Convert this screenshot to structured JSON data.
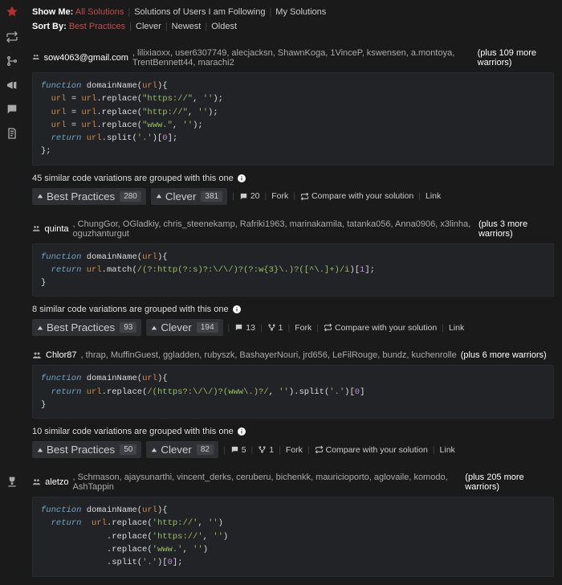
{
  "filters": {
    "show_me_label": "Show Me:",
    "show_me_opts": [
      "All Solutions",
      "Solutions of Users I am Following",
      "My Solutions"
    ],
    "show_me_active": 0,
    "sort_by_label": "Sort By:",
    "sort_by_opts": [
      "Best Practices",
      "Clever",
      "Newest",
      "Oldest"
    ],
    "sort_by_active": 0
  },
  "action_labels": {
    "best_practices": "Best Practices",
    "clever": "Clever",
    "fork": "Fork",
    "compare": "Compare with your solution",
    "link": "Link"
  },
  "solutions": [
    {
      "primary_user": "sow4063@gmail.com",
      "other_users": ", lilixiaoxx, user6307749, alecjacksn, ShawnKoga, 1VinceP, kswensen, a.montoya, TrentBennett44, marachi2 ",
      "plus": "(plus 109 more warriors)",
      "code_html": "<span class=\"tok-kw\">function</span> <span class=\"tok-fn\">domainName</span><span class=\"tok-p\">(</span><span class=\"tok-id\">url</span><span class=\"tok-p\">){</span>\n  <span class=\"tok-id\">url</span> <span class=\"tok-o\">=</span> <span class=\"tok-id\">url</span><span class=\"tok-p\">.</span><span class=\"tok-fn\">replace</span><span class=\"tok-p\">(</span><span class=\"tok-s\">\"https://\"</span><span class=\"tok-p\">, </span><span class=\"tok-s\">''</span><span class=\"tok-p\">);</span>\n  <span class=\"tok-id\">url</span> <span class=\"tok-o\">=</span> <span class=\"tok-id\">url</span><span class=\"tok-p\">.</span><span class=\"tok-fn\">replace</span><span class=\"tok-p\">(</span><span class=\"tok-s\">\"http://\"</span><span class=\"tok-p\">, </span><span class=\"tok-s\">''</span><span class=\"tok-p\">);</span>\n  <span class=\"tok-id\">url</span> <span class=\"tok-o\">=</span> <span class=\"tok-id\">url</span><span class=\"tok-p\">.</span><span class=\"tok-fn\">replace</span><span class=\"tok-p\">(</span><span class=\"tok-s\">\"www.\"</span><span class=\"tok-p\">, </span><span class=\"tok-s\">''</span><span class=\"tok-p\">);</span>\n  <span class=\"tok-kw\">return</span> <span class=\"tok-id\">url</span><span class=\"tok-p\">.</span><span class=\"tok-fn\">split</span><span class=\"tok-p\">(</span><span class=\"tok-s\">'.'</span><span class=\"tok-p\">)[</span><span class=\"tok-n\">0</span><span class=\"tok-p\">];</span>\n<span class=\"tok-p\">};</span>",
      "grouped": "45 similar code variations are grouped with this one",
      "bp": "280",
      "cl": "381",
      "comments": "20",
      "forks": null
    },
    {
      "primary_user": "quinta",
      "other_users": ", ChungGor, OGladkiy, chris_steenekamp, Rafriki1963, marinakamila, tatanka056, Anna0906, x3linha, oguzhanturgut ",
      "plus": "(plus 3 more warriors)",
      "code_html": "<span class=\"tok-kw\">function</span> <span class=\"tok-fn\">domainName</span><span class=\"tok-p\">(</span><span class=\"tok-id\">url</span><span class=\"tok-p\">){</span>\n  <span class=\"tok-kw\">return</span> <span class=\"tok-id\">url</span><span class=\"tok-p\">.</span><span class=\"tok-fn\">match</span><span class=\"tok-p\">(</span><span class=\"tok-s\">/(?:http(?:s)?:\\/\\/)?(?:w{3}\\.)?([^\\.]+)/i</span><span class=\"tok-p\">)[</span><span class=\"tok-n\">1</span><span class=\"tok-p\">];</span>\n<span class=\"tok-p\">}</span>",
      "grouped": "8 similar code variations are grouped with this one",
      "bp": "93",
      "cl": "194",
      "comments": "13",
      "forks": "1"
    },
    {
      "primary_user": "Chlor87",
      "other_users": ", thrap, MuffinGuest, ggladden, rubyszk, BashayerNouri, jrd656, LeFilRouge, bundz, kuchenrolle ",
      "plus": "(plus 6 more warriors)",
      "code_html": "<span class=\"tok-kw\">function</span> <span class=\"tok-fn\">domainName</span><span class=\"tok-p\">(</span><span class=\"tok-id\">url</span><span class=\"tok-p\">){</span>\n  <span class=\"tok-kw\">return</span> <span class=\"tok-id\">url</span><span class=\"tok-p\">.</span><span class=\"tok-fn\">replace</span><span class=\"tok-p\">(</span><span class=\"tok-s\">/(https?:\\/\\/)?(www\\.)?/</span><span class=\"tok-p\">, </span><span class=\"tok-s\">''</span><span class=\"tok-p\">).</span><span class=\"tok-fn\">split</span><span class=\"tok-p\">(</span><span class=\"tok-s\">'.'</span><span class=\"tok-p\">)[</span><span class=\"tok-n\">0</span><span class=\"tok-p\">]</span>\n<span class=\"tok-p\">}</span>",
      "grouped": "10 similar code variations are grouped with this one",
      "bp": "50",
      "cl": "82",
      "comments": "5",
      "forks": "1"
    },
    {
      "primary_user": "aletzo",
      "other_users": ", Schmason, ajaysunarthi, vincent_derks, ceruberu, bichenkk, mauricioporto, aglovaile, komodo, AshTappin ",
      "plus": "(plus 205 more warriors)",
      "code_html": "<span class=\"tok-kw\">function</span> <span class=\"tok-fn\">domainName</span><span class=\"tok-p\">(</span><span class=\"tok-id\">url</span><span class=\"tok-p\">){</span>\n  <span class=\"tok-kw\">return</span>  <span class=\"tok-id\">url</span><span class=\"tok-p\">.</span><span class=\"tok-fn\">replace</span><span class=\"tok-p\">(</span><span class=\"tok-s\">'http://'</span><span class=\"tok-p\">, </span><span class=\"tok-s\">''</span><span class=\"tok-p\">)</span>\n             <span class=\"tok-p\">.</span><span class=\"tok-fn\">replace</span><span class=\"tok-p\">(</span><span class=\"tok-s\">'https://'</span><span class=\"tok-p\">, </span><span class=\"tok-s\">''</span><span class=\"tok-p\">)</span>\n             <span class=\"tok-p\">.</span><span class=\"tok-fn\">replace</span><span class=\"tok-p\">(</span><span class=\"tok-s\">'www.'</span><span class=\"tok-p\">, </span><span class=\"tok-s\">''</span><span class=\"tok-p\">)</span>\n             <span class=\"tok-p\">.</span><span class=\"tok-fn\">split</span><span class=\"tok-p\">(</span><span class=\"tok-s\">'.'</span><span class=\"tok-p\">)[</span><span class=\"tok-n\">0</span><span class=\"tok-p\">];</span>",
      "grouped": null,
      "bp": null,
      "cl": null,
      "comments": null,
      "forks": null
    }
  ]
}
